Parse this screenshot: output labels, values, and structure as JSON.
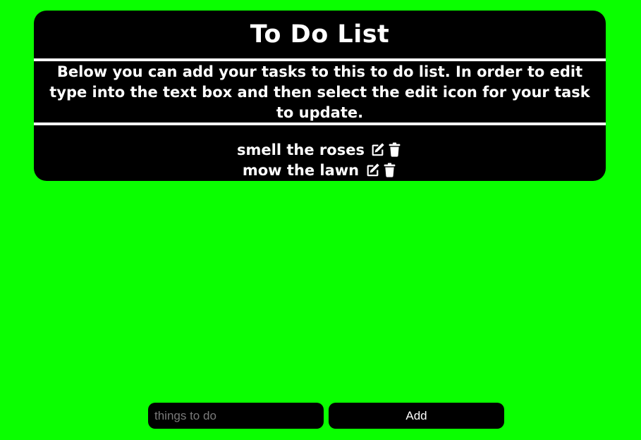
{
  "header": {
    "title": "To Do List",
    "description": "Below you can add your tasks to this to do list. In order to edit type into the text box and then select the edit icon for your task to update."
  },
  "tasks": [
    {
      "text": "smell the roses",
      "edit_icon": "edit-icon",
      "delete_icon": "trash-icon"
    },
    {
      "text": "mow the lawn",
      "edit_icon": "edit-icon",
      "delete_icon": "trash-icon"
    }
  ],
  "form": {
    "input_value": "",
    "placeholder": "things to do",
    "add_label": "Add"
  },
  "colors": {
    "background": "#0aff00",
    "card": "#000000",
    "text": "#ffffff"
  }
}
